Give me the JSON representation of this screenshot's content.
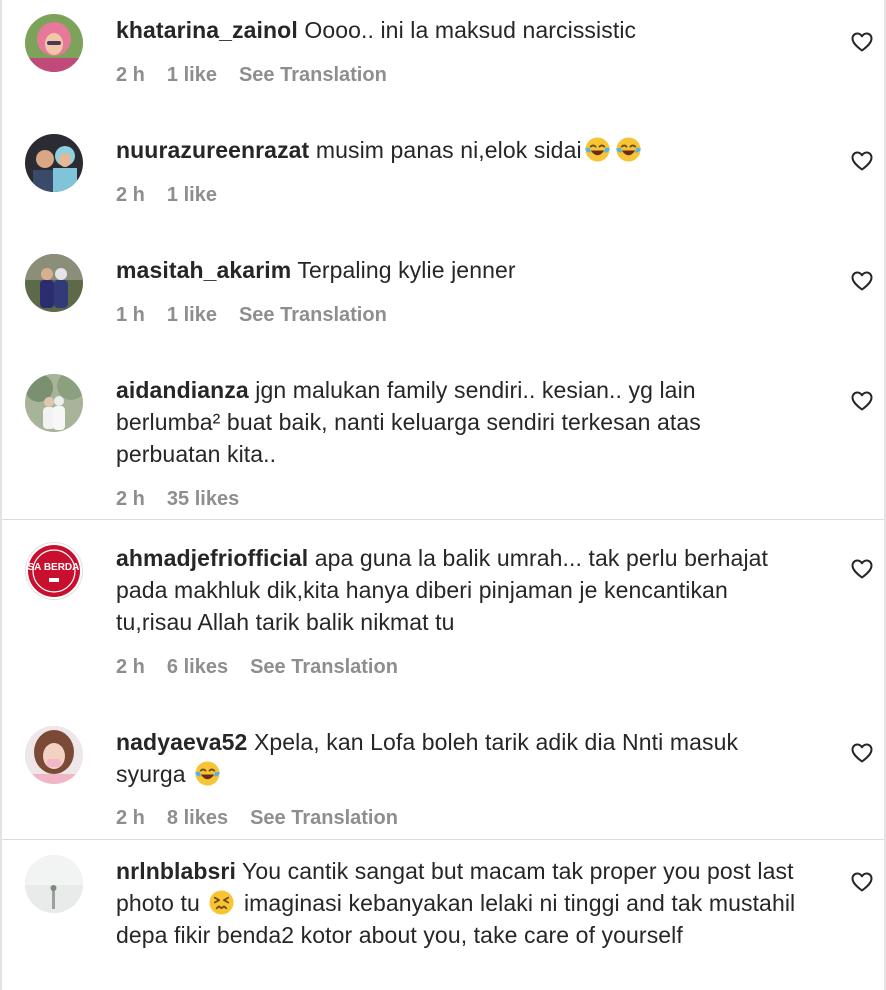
{
  "comments": [
    {
      "username": "khatarina_zainol",
      "text": "Oooo.. ini la maksud narcissistic",
      "time": "2 h",
      "likes": "1 like",
      "translation": "See Translation"
    },
    {
      "username": "nuurazureenrazat",
      "text": "musim panas ni,elok sidai",
      "time": "2 h",
      "likes": "1 like",
      "translation": ""
    },
    {
      "username": "masitah_akarim",
      "text": "Terpaling kylie jenner",
      "time": "1 h",
      "likes": "1 like",
      "translation": "See Translation"
    },
    {
      "username": "aidandianza",
      "text": "jgn malukan family sendiri.. kesian.. yg lain berlumba² buat baik, nanti keluarga sendiri terkesan atas perbuatan kita..",
      "time": "2 h",
      "likes": "35 likes",
      "translation": ""
    },
    {
      "username": "ahmadjefriofficial",
      "text": "apa guna la balik umrah... tak perlu berhajat pada makhluk dik,kita hanya diberi pinjaman je kencantikan tu,risau Allah tarik balik nikmat tu",
      "time": "2 h",
      "likes": "6 likes",
      "translation": "See Translation"
    },
    {
      "username": "nadyaeva52",
      "text": "Xpela, kan Lofa boleh tarik adik dia Nnti masuk syurga",
      "time": "2 h",
      "likes": "8 likes",
      "translation": "See Translation"
    },
    {
      "username": "nrlnblabsri",
      "text_before": "You cantik sangat but macam tak proper you post last photo tu",
      "text_after": "imaginasi kebanyakan lelaki ni tinggi and tak mustahil depa fikir benda2 kotor about you, take care of yourself",
      "time": "",
      "likes": "",
      "translation": ""
    }
  ],
  "avatar_badge": "#AOSA BERDARAH",
  "icons": {
    "like": "heart-outline-icon",
    "laugh": "face-with-tears-of-joy-emoji",
    "persevering": "persevering-face-emoji"
  },
  "colors": {
    "text": "#262626",
    "meta": "#8e8e8e",
    "divider": "#dbdbdb",
    "badge": "#c8102e"
  }
}
